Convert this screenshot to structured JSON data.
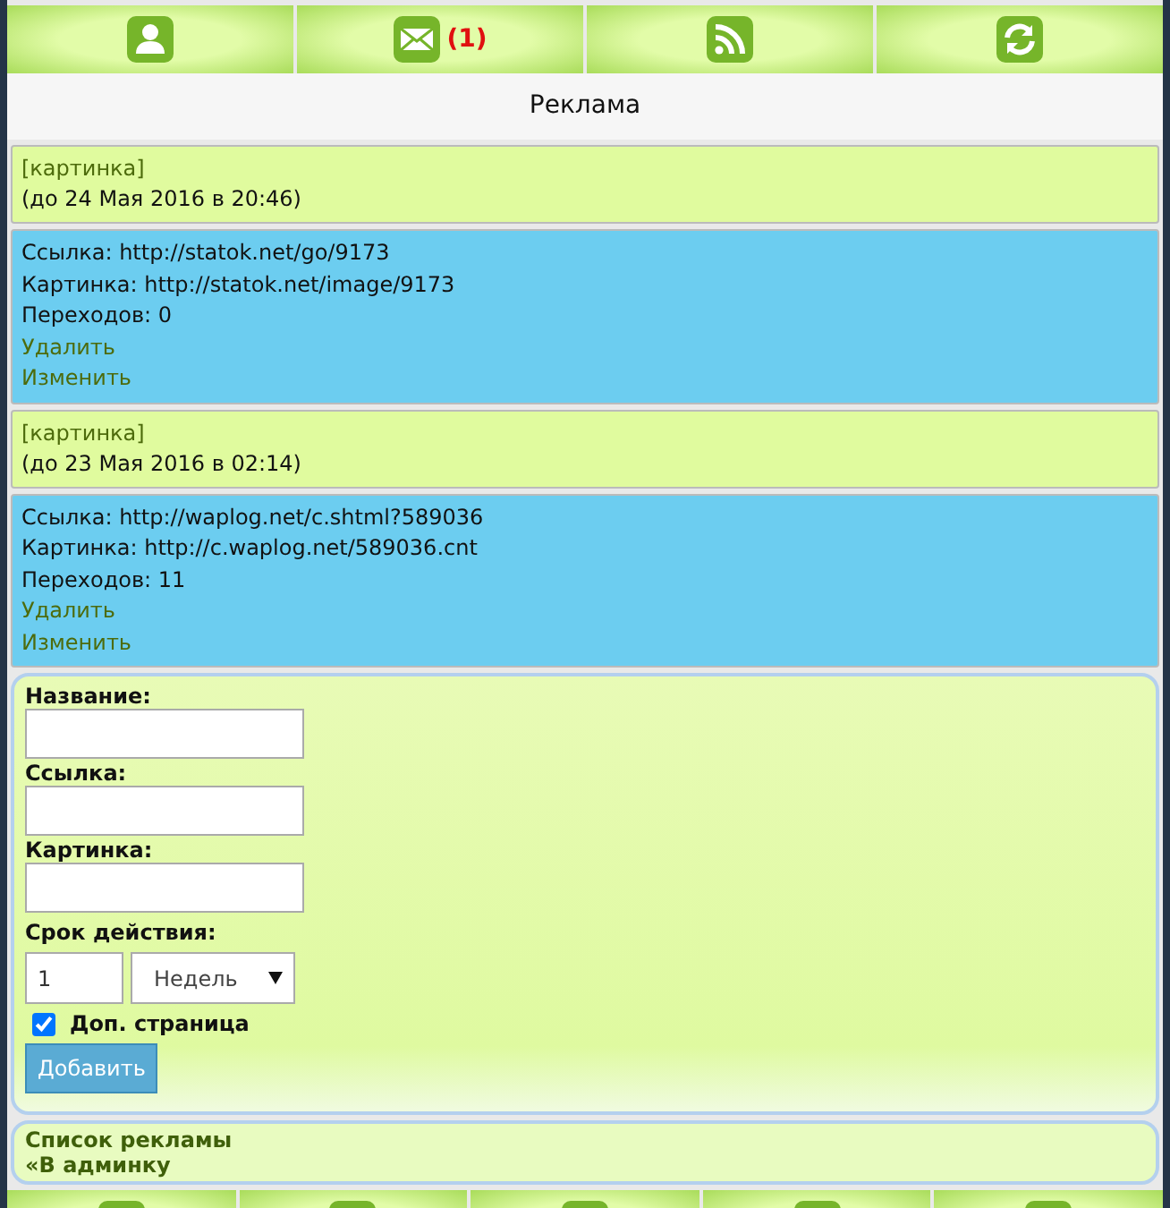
{
  "top_nav": {
    "mail_count": "(1)"
  },
  "heading": "Реклама",
  "ads": [
    {
      "picture_link": "[картинка]",
      "expires": "(до 24 Мая 2016 в 20:46)",
      "link": "Ссылка: http://statok.net/go/9173",
      "image": "Картинка: http://statok.net/image/9173",
      "clicks": "Переходов: 0",
      "actions": [
        "Удалить",
        "Изменить"
      ]
    },
    {
      "picture_link": "[картинка]",
      "expires": "(до 23 Мая 2016 в 02:14)",
      "link": "Ссылка: http://waplog.net/c.shtml?589036",
      "image": "Картинка: http://c.waplog.net/589036.cnt",
      "clicks": "Переходов: 11",
      "actions": [
        "Удалить",
        "Изменить"
      ]
    }
  ],
  "form": {
    "fields": [
      {
        "label": "Название:"
      },
      {
        "label": "Ссылка:"
      },
      {
        "label": "Картинка:"
      }
    ],
    "duration": {
      "label": "Срок действия:",
      "value": "1",
      "unit": "Недель"
    },
    "extra_page": {
      "label": "Доп. страница",
      "checked": true
    },
    "submit": "Добавить"
  },
  "footer_links": [
    "Список рекламы",
    "«В админку"
  ]
}
